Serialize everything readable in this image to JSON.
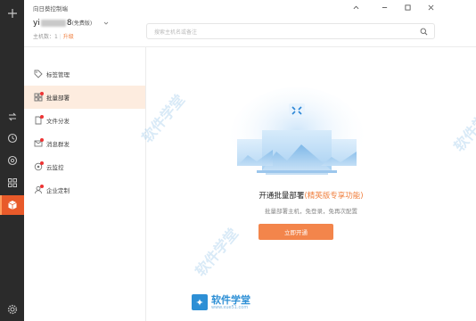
{
  "window": {
    "title": "向日葵控制端"
  },
  "account": {
    "name_prefix": "yi",
    "name_suffix": "8",
    "tag": "(免费版)",
    "host_count_label": "主机数：",
    "host_count": "1",
    "upgrade_label": "升级"
  },
  "search": {
    "placeholder": "搜索主机名或备注",
    "value": ""
  },
  "menu": {
    "items": [
      {
        "label": "标签管理",
        "icon": "tag-icon"
      },
      {
        "label": "批量部署",
        "icon": "deploy-icon"
      },
      {
        "label": "文件分发",
        "icon": "file-icon"
      },
      {
        "label": "消息群发",
        "icon": "message-icon"
      },
      {
        "label": "云监控",
        "icon": "cloud-monitor-icon"
      },
      {
        "label": "企业定制",
        "icon": "enterprise-icon"
      }
    ]
  },
  "main": {
    "headline_prefix": "开通批量部署",
    "headline_highlight": "(精英版专享功能)",
    "subline": "批量部署主机，免登录，免再次配置",
    "cta_label": "立即开通"
  },
  "watermark": {
    "text": "软件学堂",
    "logo_text": "软件学堂",
    "logo_url": "www.xue51.com"
  },
  "colors": {
    "rail_bg": "#2b2b2b",
    "accent": "#f3854b",
    "active_menu_bg": "#fdecdf",
    "watermark": "#2d8fd5"
  }
}
